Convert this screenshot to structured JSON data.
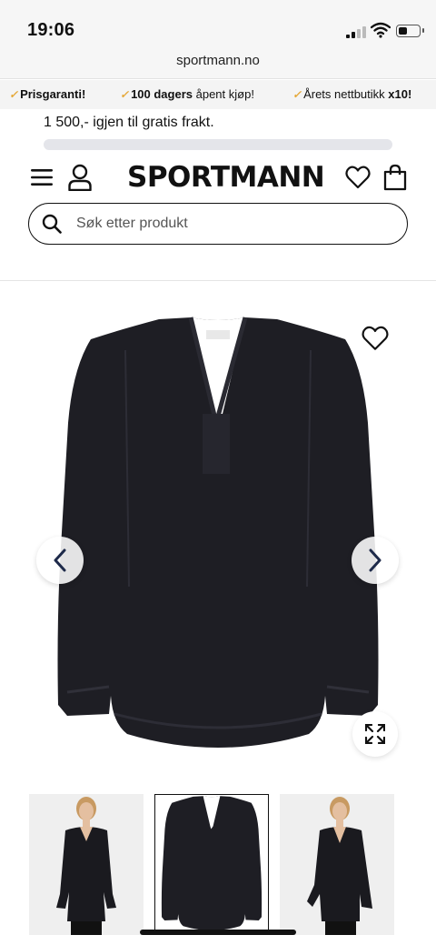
{
  "status": {
    "time": "19:06"
  },
  "browser": {
    "url": "sportmann.no"
  },
  "usp": [
    {
      "bold": "Prisgaranti!",
      "text": ""
    },
    {
      "bold": "100 dagers",
      "text": " åpent kjøp!"
    },
    {
      "bold": "",
      "text": "Årets nettbutikk ",
      "bold2": "x10!"
    }
  ],
  "shipping": {
    "message": "1 500,- igjen til gratis frakt.",
    "progress": 0
  },
  "header": {
    "logo": "SPORTMANN"
  },
  "search": {
    "placeholder": "Søk etter produkt",
    "value": ""
  },
  "colors": {
    "accent": "#e5a93a",
    "garment": "#1e1e24",
    "text": "#111111"
  },
  "gallery": {
    "main_image": "black-v-neck-blouse",
    "thumbnails": [
      {
        "image": "model-wearing-black-blouse"
      },
      {
        "image": "black-v-neck-blouse",
        "selected": true
      },
      {
        "image": "model-wearing-black-blouse-side"
      }
    ]
  },
  "icons": [
    "menu-icon",
    "user-icon",
    "heart-icon",
    "bag-icon",
    "search-icon",
    "wishlist-icon",
    "chevron-left-icon",
    "chevron-right-icon",
    "expand-icon"
  ]
}
